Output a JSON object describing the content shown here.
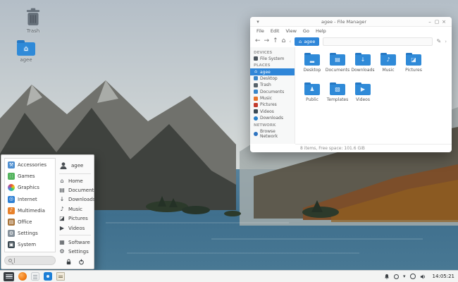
{
  "colors": {
    "accent_blue": "#2f86d8",
    "folder_blue": "#2f8ad8",
    "taskbar_bg": "#f3f4f3",
    "window_bg": "#ffffff"
  },
  "desktop": {
    "icons": [
      {
        "label": "Trash"
      },
      {
        "label": "agee"
      }
    ]
  },
  "file_manager": {
    "title": "agee - File Manager",
    "window_controls": {
      "menu": "▾",
      "minimize": "–",
      "maximize": "▢",
      "close": "×"
    },
    "menubar": [
      {
        "label": "File"
      },
      {
        "label": "Edit"
      },
      {
        "label": "View"
      },
      {
        "label": "Go"
      },
      {
        "label": "Help"
      }
    ],
    "toolbar": {
      "back": "←",
      "forward": "→",
      "up": "↑",
      "home": "⌂",
      "prev": "‹",
      "next": "›",
      "path_chip": {
        "icon": "⌂",
        "label": "agee"
      },
      "edit": "✎"
    },
    "sidebar": {
      "sections": [
        {
          "header": "DEVICES",
          "items": [
            {
              "label": "File System"
            }
          ]
        },
        {
          "header": "PLACES",
          "items": [
            {
              "label": "agee",
              "glyph": "⌂",
              "selected": true
            },
            {
              "label": "Desktop"
            },
            {
              "label": "Trash"
            },
            {
              "label": "Documents"
            },
            {
              "label": "Music"
            },
            {
              "label": "Pictures"
            },
            {
              "label": "Videos"
            },
            {
              "label": "Downloads"
            }
          ]
        },
        {
          "header": "NETWORK",
          "items": [
            {
              "label": "Browse Network"
            }
          ]
        }
      ]
    },
    "folders": [
      {
        "label": "Desktop",
        "glyph": "▂"
      },
      {
        "label": "Documents",
        "glyph": "▤"
      },
      {
        "label": "Downloads",
        "glyph": "↓"
      },
      {
        "label": "Music",
        "glyph": "♪"
      },
      {
        "label": "Pictures",
        "glyph": "◪"
      },
      {
        "label": "Public",
        "glyph": "♟"
      },
      {
        "label": "Templates",
        "glyph": "▧"
      },
      {
        "label": "Videos",
        "glyph": "▶"
      }
    ],
    "statusbar": "8 items, Free space: 101.6 GiB"
  },
  "app_menu": {
    "user": {
      "name": "agee"
    },
    "categories": [
      {
        "label": "Accessories",
        "glyph": "⚒"
      },
      {
        "label": "Games",
        "glyph": "∷"
      },
      {
        "label": "Graphics",
        "glyph": ""
      },
      {
        "label": "Internet",
        "glyph": "◎"
      },
      {
        "label": "Multimedia",
        "glyph": "♪"
      },
      {
        "label": "Office",
        "glyph": "▤"
      },
      {
        "label": "Settings",
        "glyph": "⚙"
      },
      {
        "label": "System",
        "glyph": "▣"
      }
    ],
    "shortcuts": [
      {
        "label": "Home",
        "glyph": "⌂"
      },
      {
        "label": "Documents",
        "glyph": "▤"
      },
      {
        "label": "Downloads",
        "glyph": "↓"
      },
      {
        "label": "Music",
        "glyph": "♪"
      },
      {
        "label": "Pictures",
        "glyph": "◪"
      },
      {
        "label": "Videos",
        "glyph": "▶"
      }
    ],
    "actions": [
      {
        "label": "Software",
        "glyph": "▦"
      },
      {
        "label": "Settings",
        "glyph": "⚙"
      }
    ],
    "search": {
      "placeholder": ""
    }
  },
  "taskbar": {
    "clock": "14:05:21",
    "tray_caret": "▾"
  }
}
